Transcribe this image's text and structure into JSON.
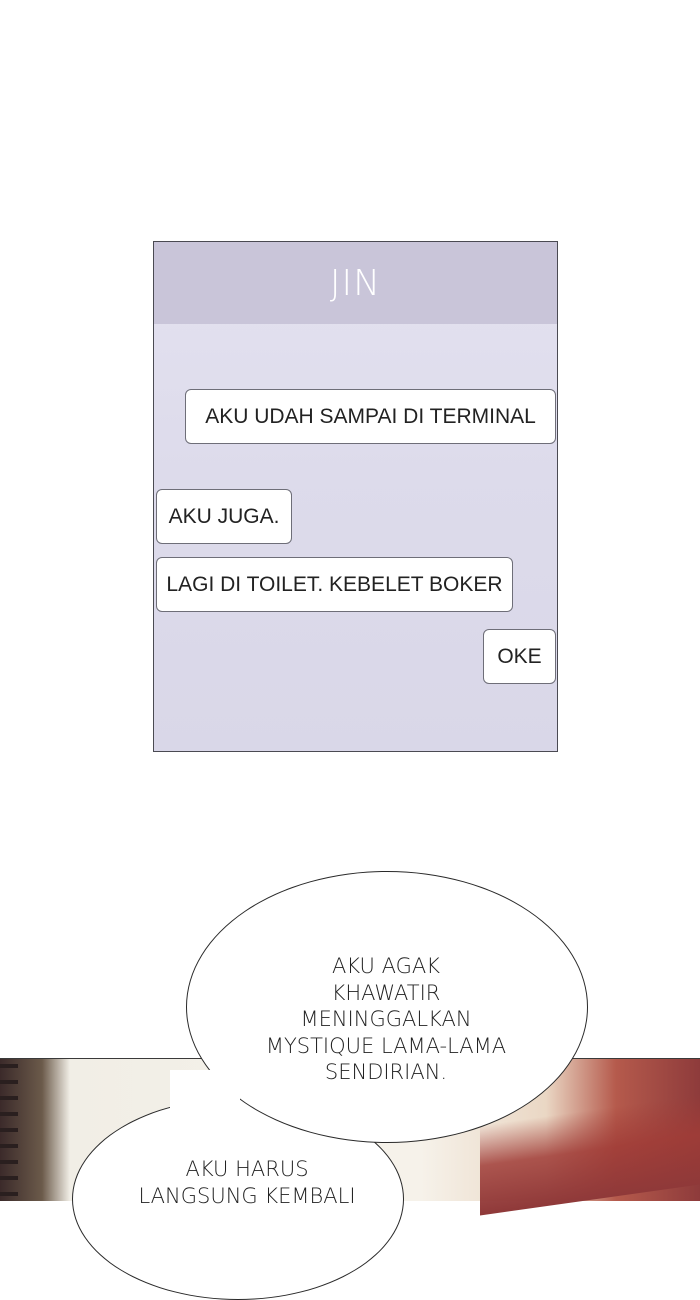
{
  "chat": {
    "contact_name": "JIN",
    "messages": [
      {
        "side": "right",
        "text": "AKU UDAH SAMPAI DI TERMINAL"
      },
      {
        "side": "left",
        "text": "AKU JUGA."
      },
      {
        "side": "left",
        "text": "LAGI DI TOILET. KEBELET BOKER"
      },
      {
        "side": "right",
        "text": "OKE"
      }
    ]
  },
  "speech_bubbles": {
    "big": {
      "lines": [
        "AKU AGAK",
        "KHAWATIR",
        "MENINGGALKAN",
        "MYSTIQUE LAMA-LAMA",
        "SENDIRIAN."
      ]
    },
    "small": {
      "lines": [
        "AKU HARUS",
        "LANGSUNG KEMBALI"
      ]
    }
  }
}
